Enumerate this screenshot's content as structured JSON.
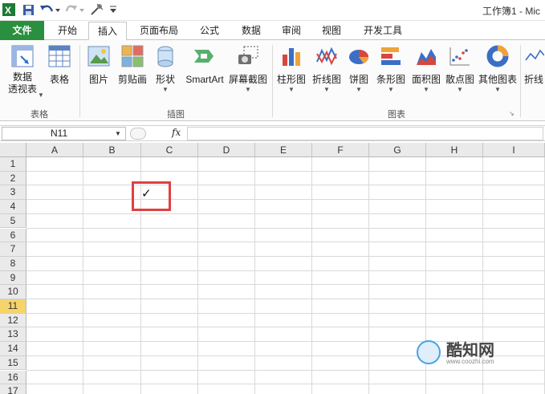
{
  "window": {
    "title": "工作簿1 - Mic"
  },
  "quick_access": [
    "excel-logo-icon",
    "save-icon",
    "undo-icon",
    "redo-icon",
    "customize-icon"
  ],
  "tabs": [
    "文件",
    "开始",
    "插入",
    "页面布局",
    "公式",
    "数据",
    "审阅",
    "视图",
    "开发工具"
  ],
  "active_tab": "插入",
  "ribbon": {
    "buttons": {
      "pivot": "数据\n透视表",
      "table": "表格",
      "picture": "图片",
      "clipart": "剪贴画",
      "shapes": "形状",
      "smartart": "SmartArt",
      "screenshot": "屏幕截图",
      "column_chart": "柱形图",
      "line_chart": "折线图",
      "pie_chart": "饼图",
      "bar_chart": "条形图",
      "area_chart": "面积图",
      "scatter_chart": "散点图",
      "other_chart": "其他图表",
      "sparkline_line": "折线"
    },
    "groups": {
      "tables": "表格",
      "illustrations": "插图",
      "charts": "图表"
    }
  },
  "formula_bar": {
    "name_box": "N11",
    "fx": "fx",
    "formula": ""
  },
  "columns": [
    "A",
    "B",
    "C",
    "D",
    "E",
    "F",
    "G",
    "H",
    "I"
  ],
  "rows": [
    "1",
    "2",
    "3",
    "4",
    "5",
    "6",
    "7",
    "8",
    "9",
    "10",
    "11",
    "12",
    "13",
    "14",
    "15",
    "16",
    "17"
  ],
  "selected_row": "11",
  "cells": {
    "C3": "✓"
  },
  "watermark": {
    "name": "酷知网",
    "url": "www.coozhi.com"
  },
  "colors": {
    "file_tab": "#2a8f3e",
    "row_highlight": "#f5d46a",
    "annotation": "#e04040"
  }
}
